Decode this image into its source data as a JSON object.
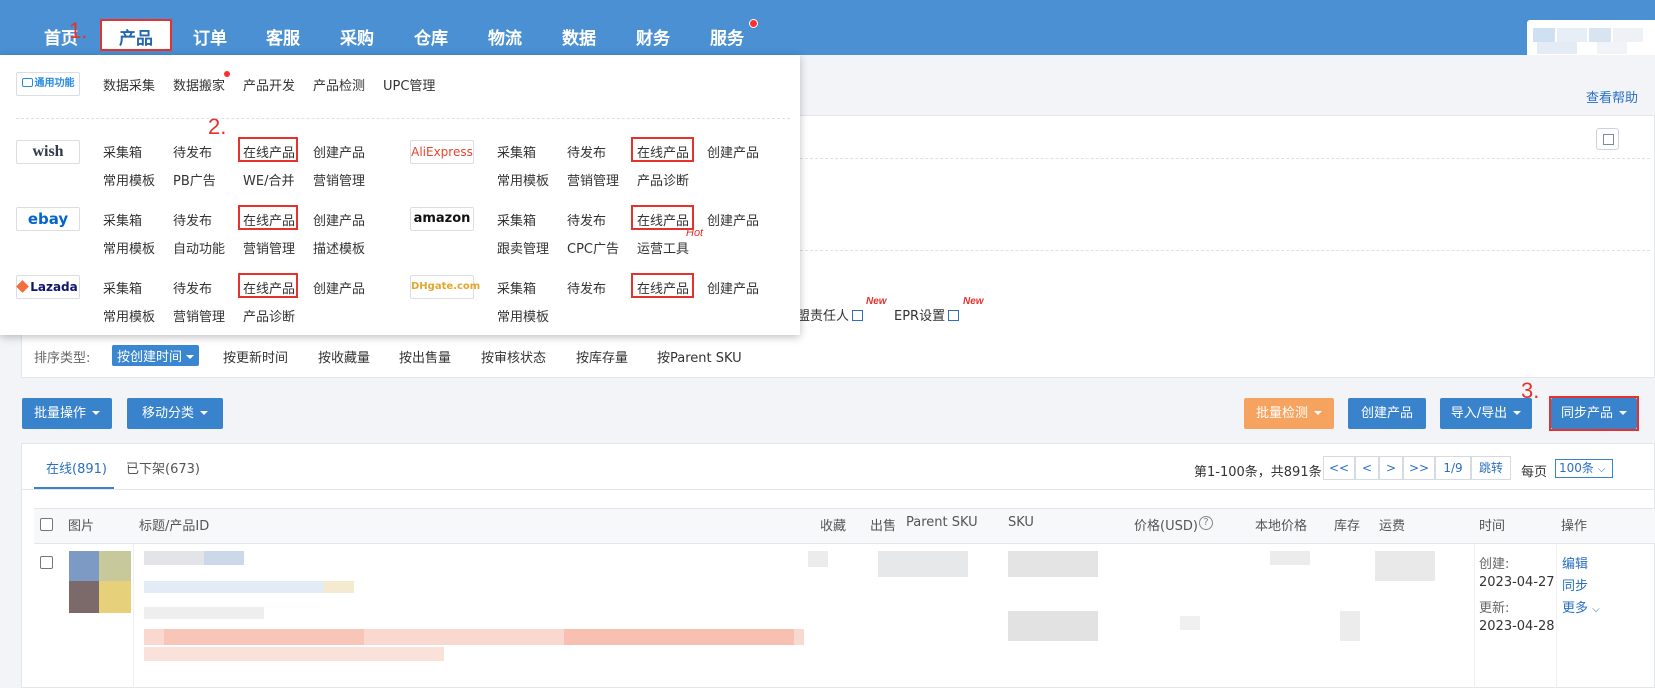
{
  "nav": {
    "items": [
      "首页",
      "产品",
      "订单",
      "客服",
      "采购",
      "仓库",
      "物流",
      "数据",
      "财务",
      "服务"
    ],
    "active": "产品"
  },
  "steps": {
    "s1": "1.",
    "s2": "2.",
    "s3": "3."
  },
  "help": "查看帮助",
  "dropdown": {
    "general_logo": "通用功能",
    "general_items": [
      "数据采集",
      "数据搬家",
      "产品开发",
      "产品检测",
      "UPC管理"
    ],
    "platforms": {
      "wish": {
        "logo": "wish",
        "row1": [
          "采集箱",
          "待发布",
          "在线产品",
          "创建产品"
        ],
        "row2": [
          "常用模板",
          "PB广告",
          "WE/合并",
          "营销管理"
        ]
      },
      "aliexpress": {
        "logo": "AliExpress",
        "row1": [
          "采集箱",
          "待发布",
          "在线产品",
          "创建产品"
        ],
        "row2": [
          "常用模板",
          "营销管理",
          "产品诊断"
        ]
      },
      "ebay": {
        "logo": "ebay",
        "row1": [
          "采集箱",
          "待发布",
          "在线产品",
          "创建产品"
        ],
        "row2": [
          "常用模板",
          "自动功能",
          "营销管理",
          "描述模板"
        ]
      },
      "amazon": {
        "logo": "amazon",
        "row1": [
          "采集箱",
          "待发布",
          "在线产品",
          "创建产品"
        ],
        "row2": [
          "跟卖管理",
          "CPC广告",
          "运营工具"
        ],
        "hot": "Hot"
      },
      "lazada": {
        "logo": "Lazada",
        "row1": [
          "采集箱",
          "待发布",
          "在线产品",
          "创建产品"
        ],
        "row2": [
          "常用模板",
          "营销管理",
          "产品诊断"
        ]
      },
      "dhgate": {
        "logo": "DHgate.com",
        "row1": [
          "采集箱",
          "待发布",
          "在线产品",
          "创建产品"
        ],
        "row2": [
          "常用模板"
        ]
      }
    }
  },
  "filters": {
    "links": [
      {
        "label": "盟责任人",
        "badge": "New"
      },
      {
        "label": "EPR设置",
        "badge": "New"
      }
    ],
    "sort_label": "排序类型:",
    "sort_active": "按创建时间",
    "sort_items": [
      "按更新时间",
      "按收藏量",
      "按出售量",
      "按审核状态",
      "按库存量",
      "按Parent SKU"
    ]
  },
  "toolbar": {
    "batch_ops": "批量操作",
    "move_category": "移动分类",
    "batch_check": "批量检测",
    "create_product": "创建产品",
    "import_export": "导入/导出",
    "sync_products": "同步产品"
  },
  "tabs": {
    "online": "在线(891)",
    "offline": "已下架(673)"
  },
  "pagination": {
    "range": "第1-100条，共891条",
    "first": "<<",
    "prev": "<",
    "next": ">",
    "last": ">>",
    "page": "1/9",
    "jump": "跳转",
    "per_page_label": "每页",
    "per_page": "100条"
  },
  "table": {
    "headers": [
      "图片",
      "标题/产品ID",
      "收藏",
      "出售",
      "Parent SKU",
      "SKU",
      "价格(USD)",
      "本地价格",
      "库存",
      "运费",
      "时间",
      "操作"
    ],
    "row": {
      "created_label": "创建:",
      "created": "2023-04-27",
      "updated_label": "更新:",
      "updated": "2023-04-28",
      "ops": [
        "编辑",
        "同步",
        "更多"
      ]
    }
  },
  "colors": {
    "nav_bg": "#4a90d3",
    "accent": "#3883cc",
    "highlight": "#e5322d",
    "orange": "#f5a35f"
  }
}
